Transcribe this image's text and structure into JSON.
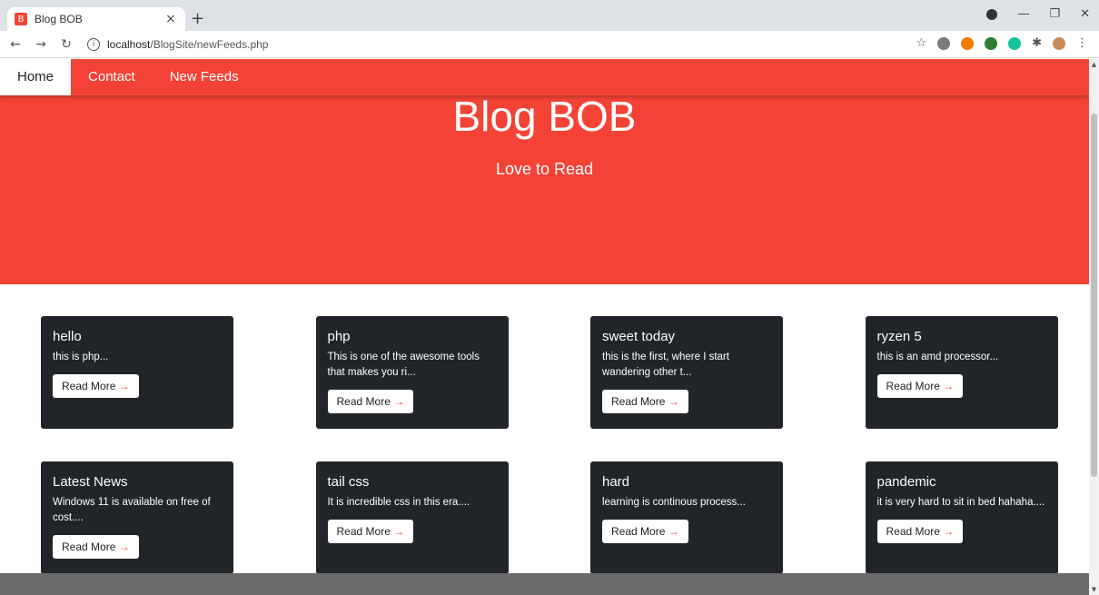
{
  "browser": {
    "tab_title": "Blog BOB",
    "tab_favicon": "blogger-icon",
    "new_tab": "+",
    "url_host": "localhost",
    "url_path": "/BlogSite/newFeeds.php"
  },
  "nav": {
    "items": [
      {
        "label": "Home",
        "active": true
      },
      {
        "label": "Contact",
        "active": false
      },
      {
        "label": "New Feeds",
        "active": false
      }
    ]
  },
  "hero": {
    "title": "Blog BOB",
    "subtitle": "Love to Read"
  },
  "posts": [
    {
      "title": "hello",
      "excerpt": "this is php...",
      "button": "Read More",
      "arrow": "→"
    },
    {
      "title": "php",
      "excerpt": "This is one of the awesome tools that makes you ri...",
      "button": "Read More",
      "arrow": "→"
    },
    {
      "title": "sweet today",
      "excerpt": "this is the first, where I start wandering other t...",
      "button": "Read More",
      "arrow": "→"
    },
    {
      "title": "ryzen 5",
      "excerpt": "this is an amd processor...",
      "button": "Read More",
      "arrow": "→"
    },
    {
      "title": "Latest News",
      "excerpt": "Windows 11 is available on free of cost....",
      "button": "Read More",
      "arrow": "→"
    },
    {
      "title": "tail css",
      "excerpt": "It is incredible css in this era....",
      "button": "Read More",
      "arrow": "→"
    },
    {
      "title": "hard",
      "excerpt": "learning is continous process...",
      "button": "Read More",
      "arrow": "→"
    },
    {
      "title": "pandemic",
      "excerpt": "it is very hard to sit in bed hahaha....",
      "button": "Read More",
      "arrow": "→"
    }
  ],
  "colors": {
    "brand": "#f44336",
    "card": "#212529",
    "footer": "#6b6b6b"
  }
}
